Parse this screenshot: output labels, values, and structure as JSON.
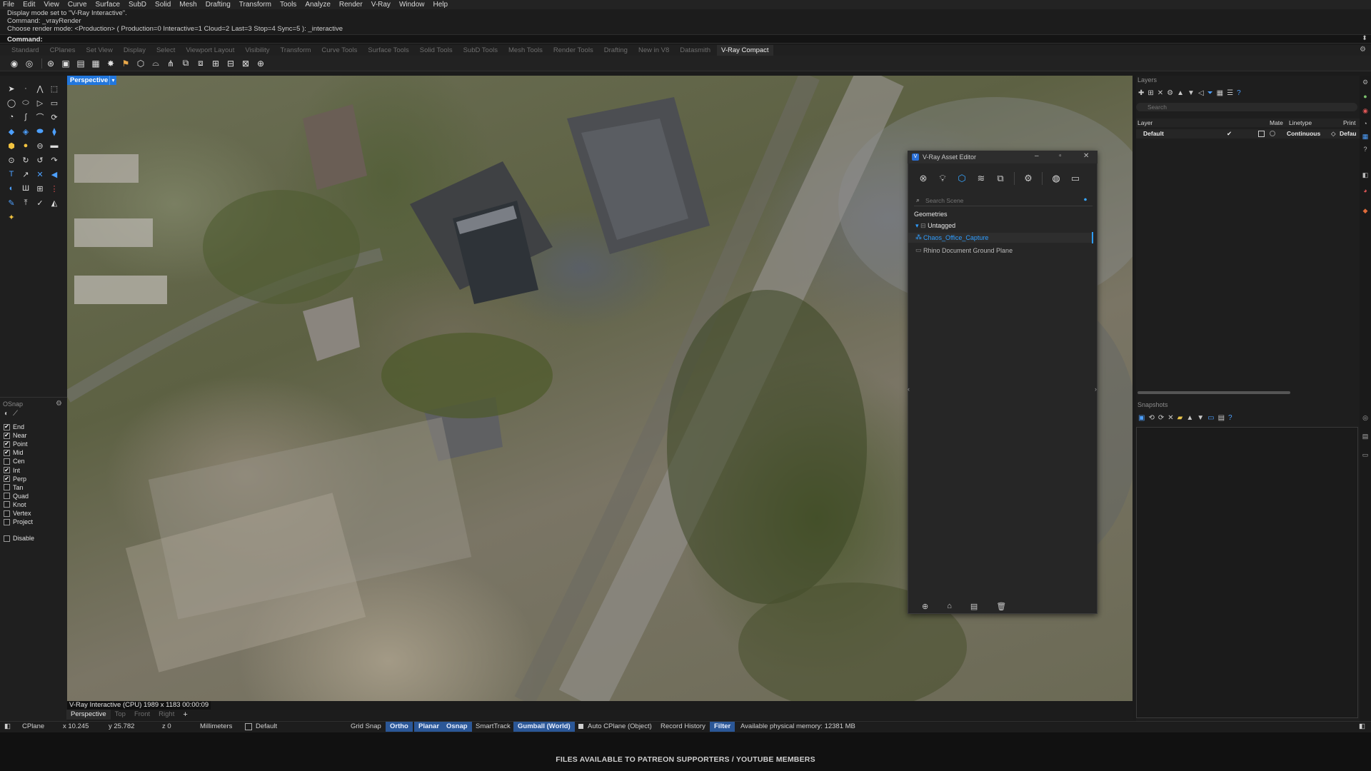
{
  "menu": [
    "File",
    "Edit",
    "View",
    "Curve",
    "Surface",
    "SubD",
    "Solid",
    "Mesh",
    "Drafting",
    "Transform",
    "Tools",
    "Analyze",
    "Render",
    "V-Ray",
    "Window",
    "Help"
  ],
  "command_history": [
    "Display mode set to \"V-Ray Interactive\".",
    "Command: _vrayRender",
    "Choose render mode: <Production> ( Production=0  Interactive=1  Cloud=2  Last=3  Stop=4  Sync=5 ): _interactive"
  ],
  "command_prompt": "Command:",
  "toolbar_tabs": [
    "Standard",
    "CPlanes",
    "Set View",
    "Display",
    "Select",
    "Viewport Layout",
    "Visibility",
    "Transform",
    "Curve Tools",
    "Surface Tools",
    "Solid Tools",
    "SubD Tools",
    "Mesh Tools",
    "Render Tools",
    "Drafting",
    "New in V8",
    "Datasmith",
    "V-Ray Compact"
  ],
  "active_toolbar_tab": "V-Ray Compact",
  "viewport": {
    "name": "Perspective",
    "status": "V-Ray Interactive (CPU)   1989 x 1183   00:00:09",
    "tabs": [
      "Perspective",
      "Top",
      "Front",
      "Right"
    ],
    "add_tab": "+"
  },
  "osnap": {
    "title": "OSnap",
    "items": [
      {
        "label": "End",
        "checked": true
      },
      {
        "label": "Near",
        "checked": true
      },
      {
        "label": "Point",
        "checked": true
      },
      {
        "label": "Mid",
        "checked": true
      },
      {
        "label": "Cen",
        "checked": false
      },
      {
        "label": "Int",
        "checked": true
      },
      {
        "label": "Perp",
        "checked": true
      },
      {
        "label": "Tan",
        "checked": false
      },
      {
        "label": "Quad",
        "checked": false
      },
      {
        "label": "Knot",
        "checked": false
      },
      {
        "label": "Vertex",
        "checked": false
      },
      {
        "label": "Project",
        "checked": false
      }
    ],
    "disable": "Disable"
  },
  "layers": {
    "title": "Layers",
    "search_placeholder": "Search",
    "columns": {
      "layer": "Layer",
      "material": "Mate",
      "linetype": "Linetype",
      "print": "Print"
    },
    "rows": [
      {
        "name": "Default",
        "linetype": "Continuous",
        "print": "Defau"
      }
    ]
  },
  "snapshots": {
    "title": "Snapshots"
  },
  "vray_editor": {
    "title": "V-Ray Asset Editor",
    "search_placeholder": "Search Scene",
    "section": "Geometries",
    "group": "Untagged",
    "items": [
      "Chaos_Office_Capture",
      "Rhino Document Ground Plane"
    ]
  },
  "statusbar": {
    "cplane": "CPlane",
    "x": "x 10.245",
    "y": "y 25.782",
    "z": "z 0",
    "units": "Millimeters",
    "layer": "Default",
    "grid_snap": "Grid Snap",
    "ortho": "Ortho",
    "planar": "Planar",
    "osnap": "Osnap",
    "smarttrack": "SmartTrack",
    "gumball": "Gumball (World)",
    "auto_cplane": "Auto CPlane (Object)",
    "record_history": "Record History",
    "filter": "Filter",
    "memory": "Available physical memory: 12381 MB"
  },
  "footer": "FILES AVAILABLE TO PATREON SUPPORTERS / YOUTUBE MEMBERS",
  "colors": {
    "accent": "#2277dd",
    "vray_blue": "#2f9dff",
    "status_on": "#2b5797"
  }
}
